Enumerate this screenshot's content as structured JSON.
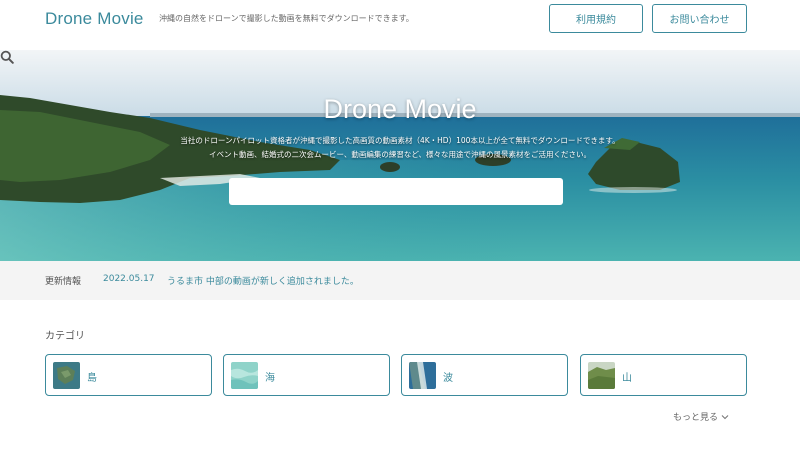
{
  "header": {
    "logo": "Drone Movie",
    "tagline": "沖縄の自然をドローンで撮影した動画を無料でダウンロードできます。",
    "terms_label": "利用規約",
    "contact_label": "お問い合わせ"
  },
  "hero": {
    "title": "Drone Movie",
    "description_line1": "当社のドローンパイロット資格者が沖縄で撮影した高画質の動画素材（4K・HD）100本以上が全て無料でダウンロードできます。",
    "description_line2": "イベント動画、結婚式の二次会ムービー、動画編集の練習など、様々な用途で沖縄の風景素材をご活用ください。",
    "search_placeholder": "",
    "search_value": ""
  },
  "updates": {
    "label": "更新情報",
    "date": "2022.05.17",
    "text": "うるま市 中部の動画が新しく追加されました。"
  },
  "categories": {
    "heading": "カテゴリ",
    "items": [
      {
        "label": "島",
        "thumb": "island"
      },
      {
        "label": "海",
        "thumb": "sea"
      },
      {
        "label": "波",
        "thumb": "wave"
      },
      {
        "label": "山",
        "thumb": "mountain"
      }
    ],
    "more_label": "もっと見る"
  },
  "colors": {
    "accent": "#3b8a9c",
    "update_bar_bg": "#f4f4f4"
  }
}
